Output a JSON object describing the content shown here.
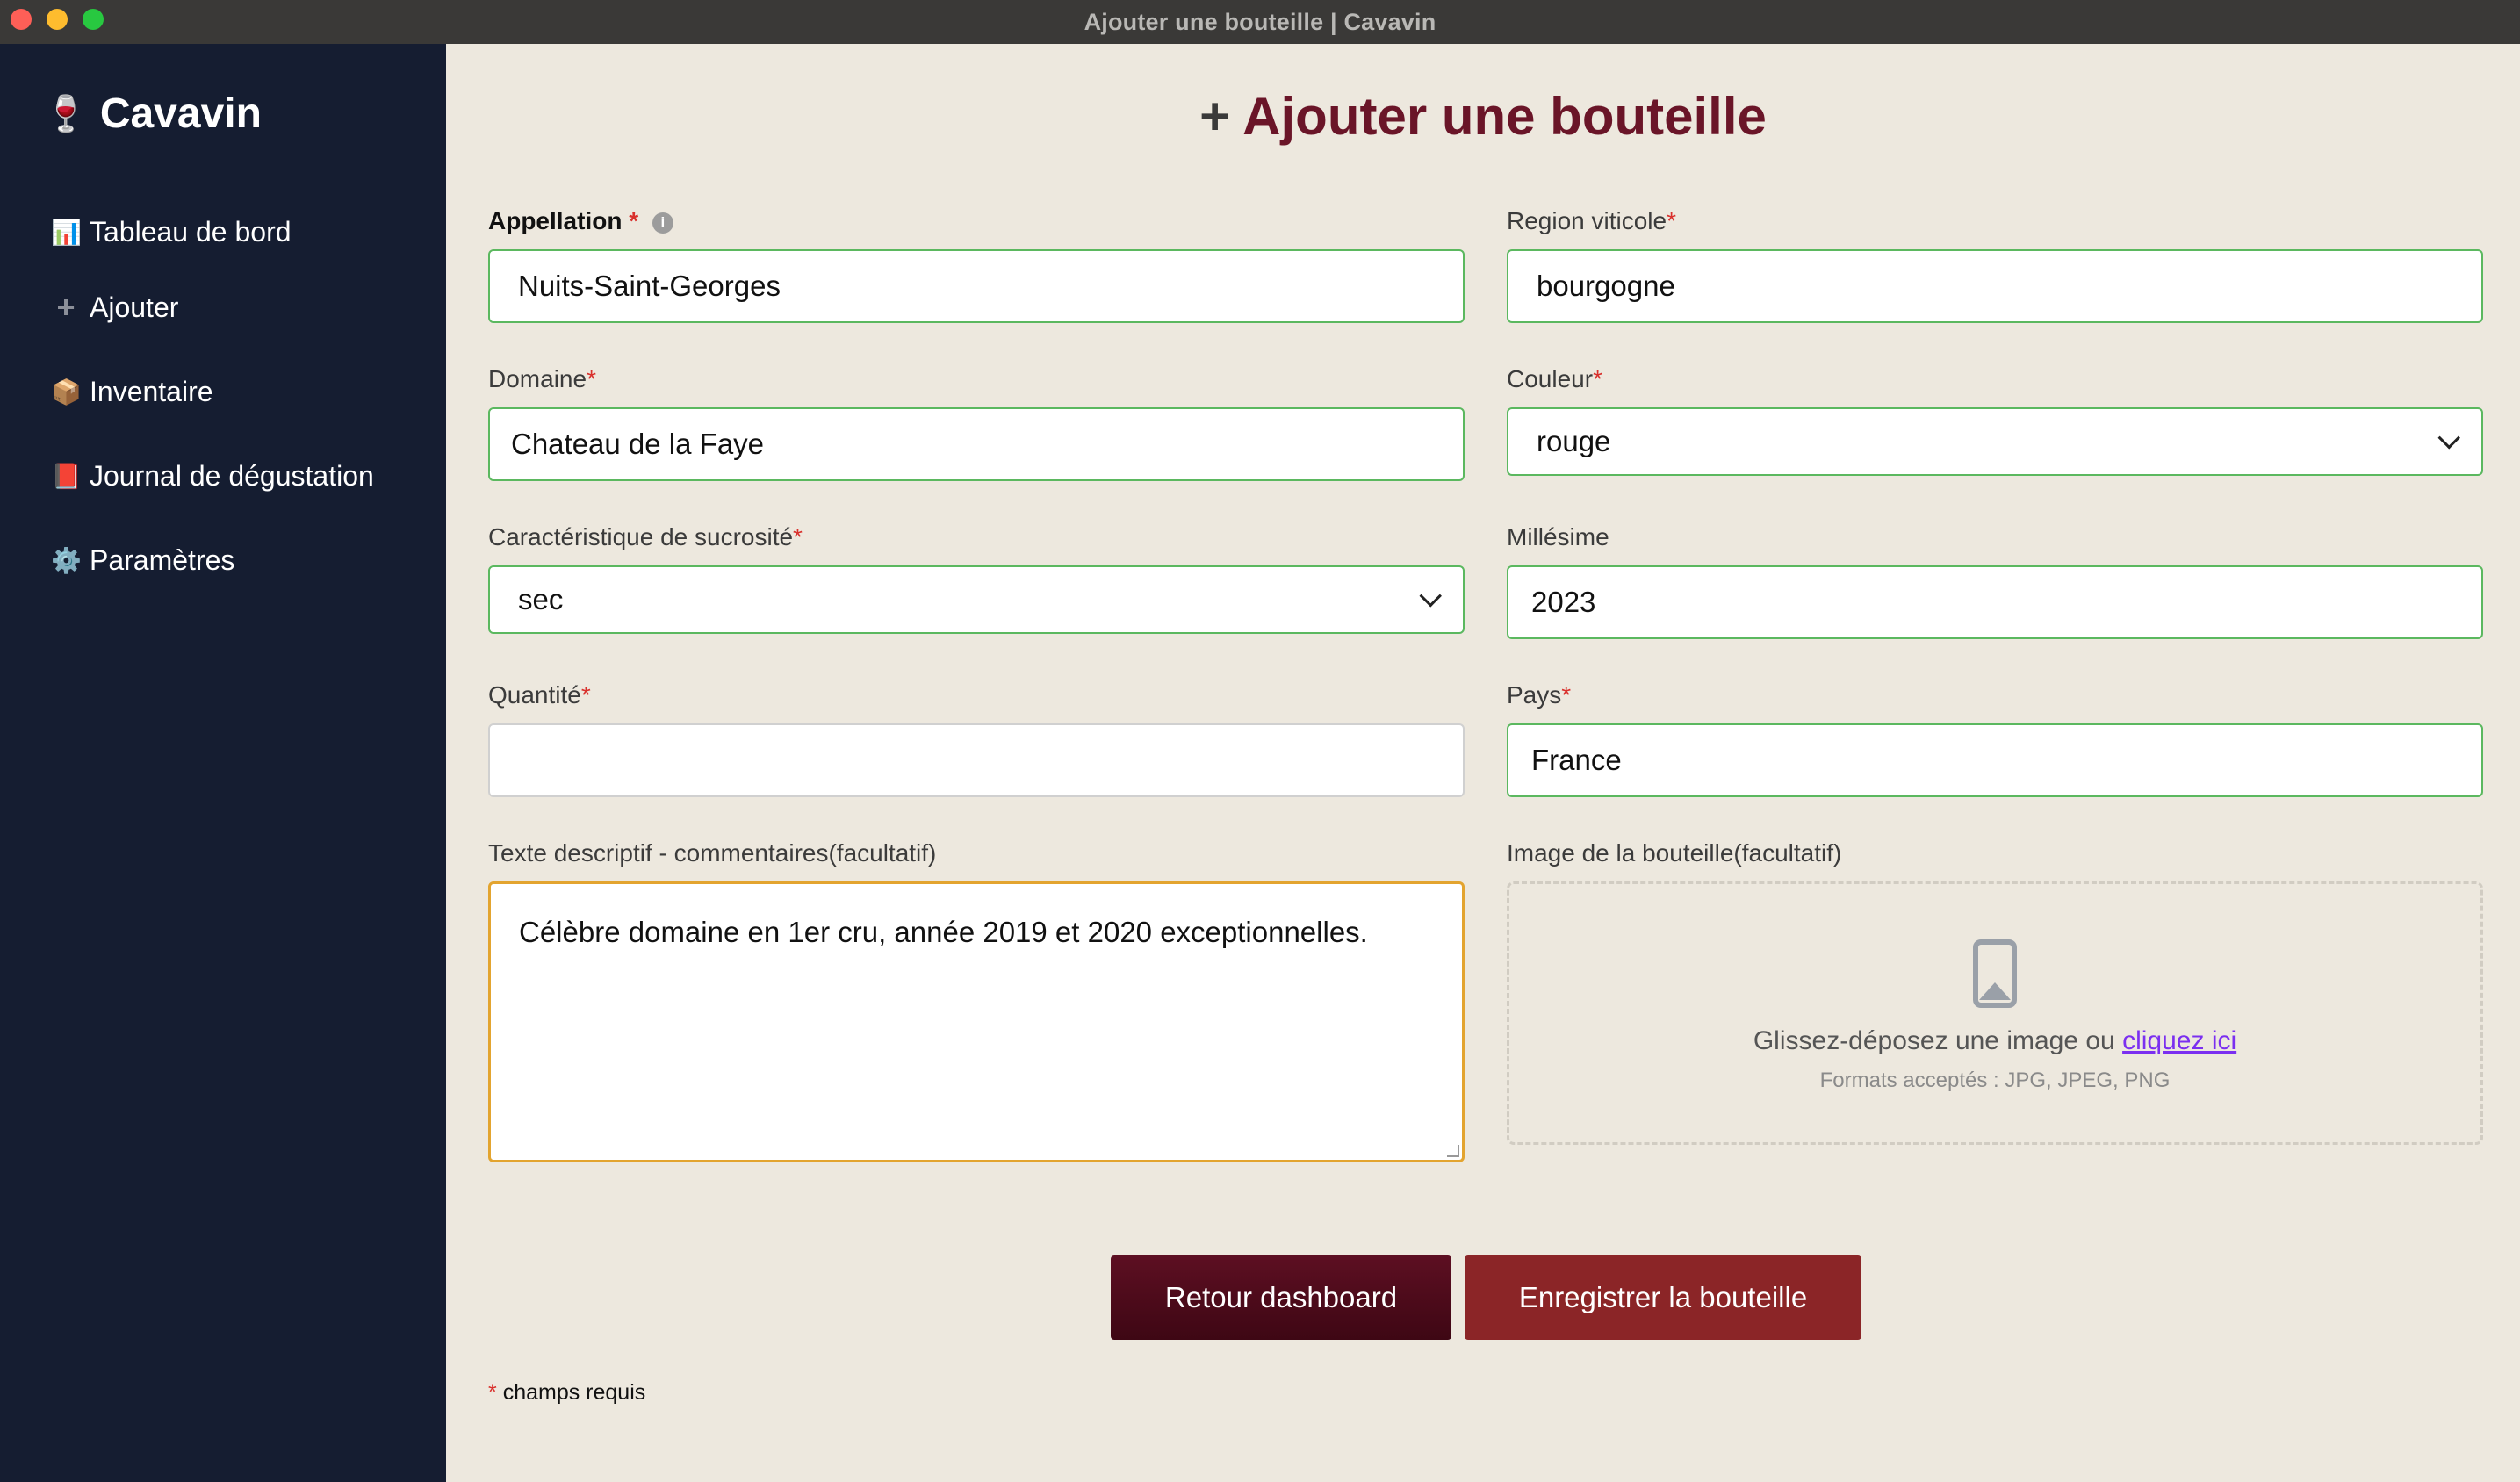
{
  "window": {
    "title": "Ajouter une bouteille | Cavavin"
  },
  "sidebar": {
    "brand": "Cavavin",
    "items": [
      {
        "icon": "📊",
        "label": "Tableau de bord"
      },
      {
        "icon": "➕",
        "label": "Ajouter"
      },
      {
        "icon": "📦",
        "label": "Inventaire"
      },
      {
        "icon": "📕",
        "label": "Journal de dégustation"
      },
      {
        "icon": "⚙️",
        "label": "Paramètres"
      }
    ]
  },
  "page": {
    "plus": "+",
    "title": "Ajouter une bouteille"
  },
  "form": {
    "required_mark": "*",
    "appellation": {
      "label": "Appellation",
      "info": "i",
      "value": "Nuits-Saint-Georges"
    },
    "region": {
      "label": "Region viticole",
      "value": "bourgogne"
    },
    "domaine": {
      "label": "Domaine",
      "value": "Chateau de la Faye"
    },
    "couleur": {
      "label": "Couleur",
      "value": "rouge"
    },
    "sucrosite": {
      "label": "Caractéristique de sucrosité",
      "value": "sec"
    },
    "millesime": {
      "label": "Millésime",
      "value": "2023"
    },
    "quantite": {
      "label": "Quantité",
      "value": ""
    },
    "pays": {
      "label": "Pays",
      "value": "France"
    },
    "description": {
      "label": "Texte descriptif - commentaires(facultatif)",
      "value": "Célèbre domaine en 1er cru, année 2019 et 2020 exceptionnelles."
    },
    "image": {
      "label": "Image de la bouteille(facultatif)",
      "drop_text": "Glissez-déposez une image ou",
      "link": "cliquez ici",
      "formats": "Formats acceptés : JPG, JPEG, PNG"
    }
  },
  "buttons": {
    "back": "Retour dashboard",
    "save": "Enregistrer la bouteille"
  },
  "footnote": {
    "mark": "*",
    "text": "champs requis"
  },
  "colors": {
    "sidebar": "#151d31",
    "title": "#6a1528",
    "valid_border": "#5bb85f",
    "focus_border": "#e3a42f",
    "back_button": "#4e0b1b",
    "save_button": "#8b2527"
  }
}
